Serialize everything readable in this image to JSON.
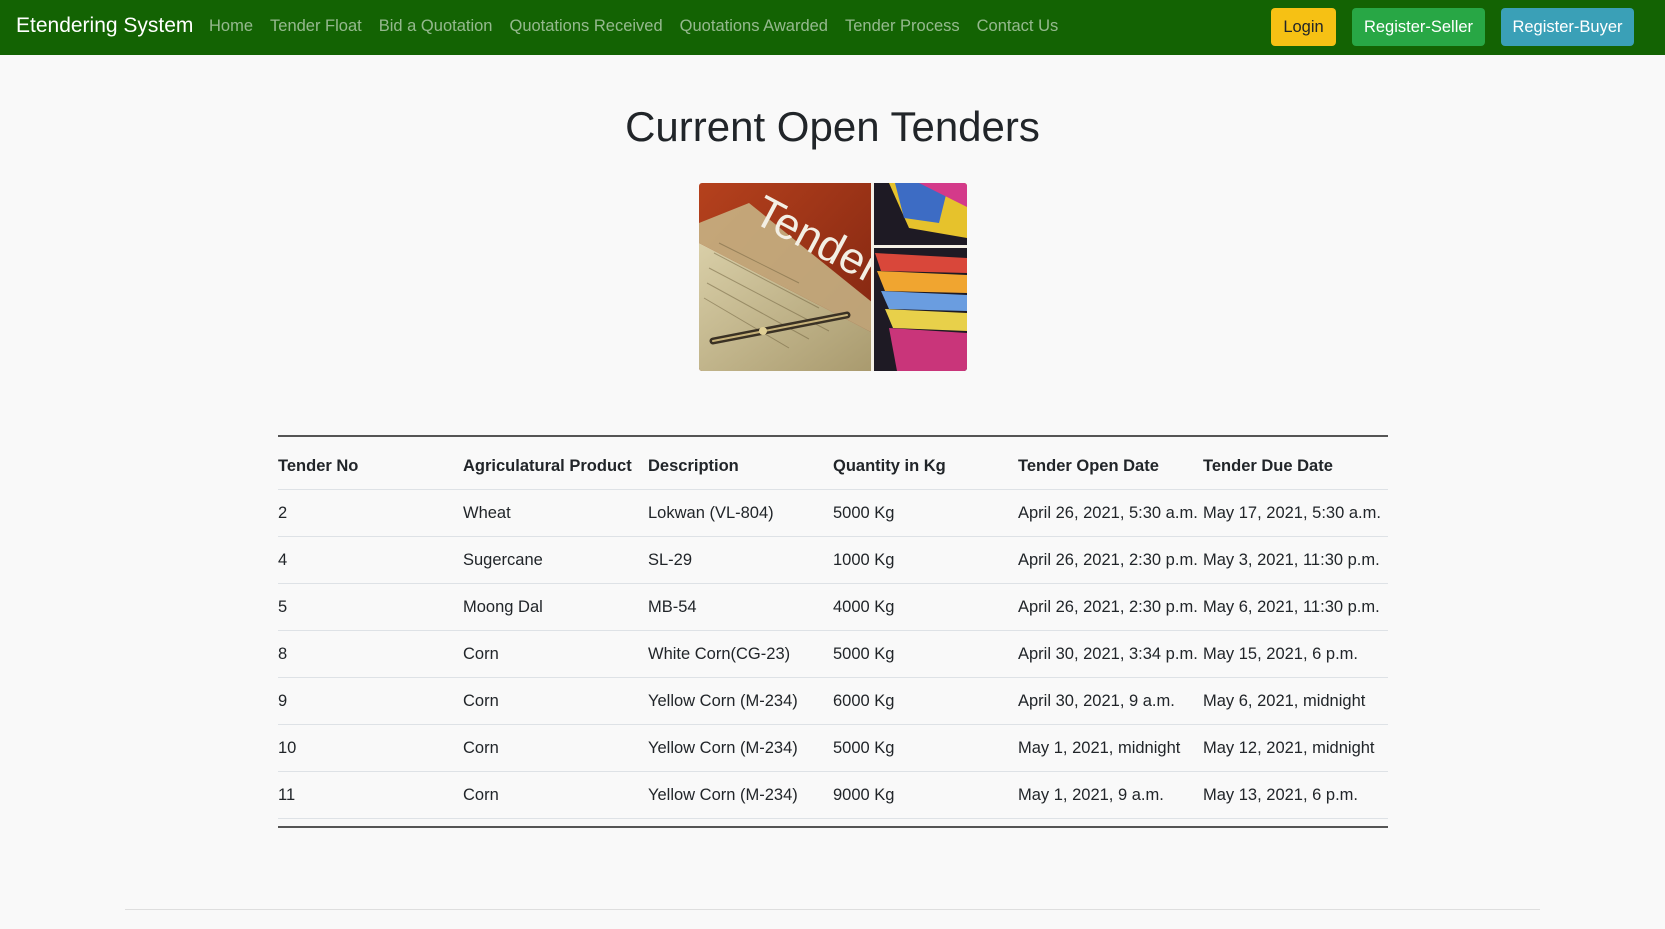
{
  "navbar": {
    "brand": "Etendering System",
    "links": [
      "Home",
      "Tender Float",
      "Bid a Quotation",
      "Quotations Received",
      "Quotations Awarded",
      "Tender Process",
      "Contact Us"
    ],
    "login_label": "Login",
    "register_seller_label": "Register-Seller",
    "register_buyer_label": "Register-Buyer",
    "colors": {
      "background": "#136303",
      "login": "#f6c114",
      "seller": "#28a745",
      "buyer": "#3aa0b7"
    }
  },
  "main": {
    "title": "Current Open Tenders",
    "hero_image_text": "Tenders"
  },
  "table": {
    "headers": [
      "Tender No",
      "Agriculatural Product",
      "Description",
      "Quantity in Kg",
      "Tender Open Date",
      "Tender Due Date"
    ],
    "rows": [
      [
        "2",
        "Wheat",
        "Lokwan (VL-804)",
        "5000 Kg",
        "April 26, 2021, 5:30 a.m.",
        "May 17, 2021, 5:30 a.m."
      ],
      [
        "4",
        "Sugercane",
        "SL-29",
        "1000 Kg",
        "April 26, 2021, 2:30 p.m.",
        "May 3, 2021, 11:30 p.m."
      ],
      [
        "5",
        "Moong Dal",
        "MB-54",
        "4000 Kg",
        "April 26, 2021, 2:30 p.m.",
        "May 6, 2021, 11:30 p.m."
      ],
      [
        "8",
        "Corn",
        "White Corn(CG-23)",
        "5000 Kg",
        "April 30, 2021, 3:34 p.m.",
        "May 15, 2021, 6 p.m."
      ],
      [
        "9",
        "Corn",
        "Yellow Corn (M-234)",
        "6000 Kg",
        "April 30, 2021, 9 a.m.",
        "May 6, 2021, midnight"
      ],
      [
        "10",
        "Corn",
        "Yellow Corn (M-234)",
        "5000 Kg",
        "May 1, 2021, midnight",
        "May 12, 2021, midnight"
      ],
      [
        "11",
        "Corn",
        "Yellow Corn (M-234)",
        "9000 Kg",
        "May 1, 2021, 9 a.m.",
        "May 13, 2021, 6 p.m."
      ]
    ]
  }
}
